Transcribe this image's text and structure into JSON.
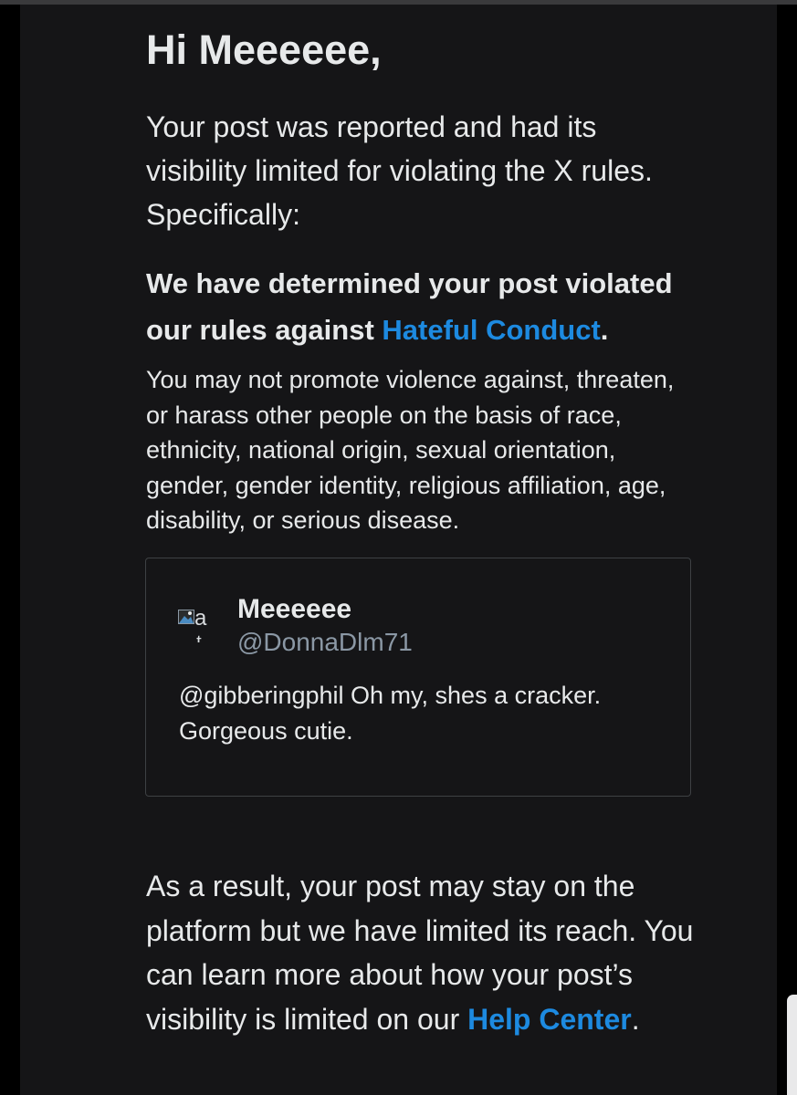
{
  "email": {
    "greeting": "Hi Meeeeee,",
    "intro": "Your post was reported and had its visibility limited for violating the X rules. Specifically:",
    "determination_prefix": "We have determined your post violated our rules against ",
    "policy_link": "Hateful Conduct",
    "determination_suffix": ".",
    "policy_description": "You may not promote violence against, threaten, or harass other people on the basis of race, ethnicity, national origin, sexual orientation, gender, gender identity, religious affiliation, age, disability, or serious disease.",
    "quoted_post": {
      "avatar_alt_line1": "a",
      "avatar_alt_line2": "..t",
      "display_name": "Meeeeee",
      "handle": "@DonnaDlm71",
      "text": "@gibberingphil Oh my, shes a cracker. Gorgeous cutie."
    },
    "result_text": "As a result, your post may stay on the platform but we have limited its reach. You can learn more about how your post’s visibility is limited on our ",
    "help_link": "Help Center",
    "result_suffix": "."
  },
  "colors": {
    "page_background": "#000000",
    "panel_background": "#151517",
    "text": "#e7e9ea",
    "link": "#1d8ae0",
    "muted": "#8b98a5",
    "border": "#3e4144"
  },
  "icons": {
    "avatar": "broken-image-icon"
  }
}
